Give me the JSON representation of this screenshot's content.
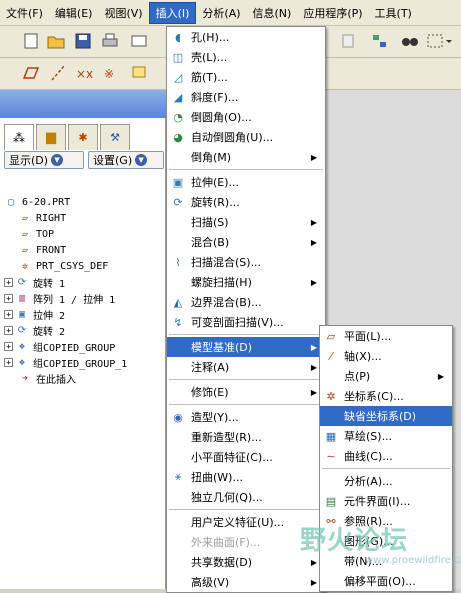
{
  "menubar": {
    "items": [
      "文件(F)",
      "编辑(E)",
      "视图(V)",
      "插入(I)",
      "分析(A)",
      "信息(N)",
      "应用程序(P)",
      "工具(T)"
    ],
    "active_index": 3
  },
  "panel": {
    "display_label": "显示(D)",
    "settings_label": "设置(G)",
    "tree": [
      {
        "text": "6-20.PRT",
        "icon": "part-icon",
        "expander": false,
        "indent": 0
      },
      {
        "text": "RIGHT",
        "icon": "datum-plane-icon",
        "expander": false,
        "indent": 1
      },
      {
        "text": "TOP",
        "icon": "datum-plane-icon",
        "expander": false,
        "indent": 1
      },
      {
        "text": "FRONT",
        "icon": "datum-plane-icon",
        "expander": false,
        "indent": 1
      },
      {
        "text": "PRT_CSYS_DEF",
        "icon": "csys-icon",
        "expander": false,
        "indent": 1
      },
      {
        "text": "旋转 1",
        "icon": "revolve-icon",
        "expander": true,
        "indent": 0
      },
      {
        "text": "阵列 1 / 拉伸 1",
        "icon": "pattern-icon",
        "expander": true,
        "indent": 0
      },
      {
        "text": "拉伸 2",
        "icon": "extrude-icon",
        "expander": true,
        "indent": 0
      },
      {
        "text": "旋转 2",
        "icon": "revolve-icon",
        "expander": true,
        "indent": 0
      },
      {
        "text": "组COPIED_GROUP",
        "icon": "group-icon",
        "expander": true,
        "indent": 0
      },
      {
        "text": "组COPIED_GROUP_1",
        "icon": "group-icon",
        "expander": true,
        "indent": 0
      },
      {
        "text": "在此插入",
        "icon": "insert-arrow-icon",
        "expander": false,
        "indent": 1
      }
    ]
  },
  "insert_menu": [
    {
      "label": "孔(H)...",
      "icon": "hole-icon",
      "submenu": false,
      "disabled": false,
      "highlight": false
    },
    {
      "label": "壳(L)...",
      "icon": "shell-icon",
      "submenu": false,
      "disabled": false,
      "highlight": false
    },
    {
      "label": "筋(T)...",
      "icon": "rib-icon",
      "submenu": false,
      "disabled": false,
      "highlight": false
    },
    {
      "label": "斜度(F)...",
      "icon": "draft-icon",
      "submenu": false,
      "disabled": false,
      "highlight": false
    },
    {
      "label": "倒圆角(O)...",
      "icon": "round-icon",
      "submenu": false,
      "disabled": false,
      "highlight": false
    },
    {
      "label": "自动倒圆角(U)...",
      "icon": "auto-round-icon",
      "submenu": false,
      "disabled": false,
      "highlight": false
    },
    {
      "label": "倒角(M)",
      "icon": "",
      "submenu": true,
      "disabled": false,
      "highlight": false
    },
    {
      "sep": true
    },
    {
      "label": "拉伸(E)...",
      "icon": "extrude-icon",
      "submenu": false,
      "disabled": false,
      "highlight": false
    },
    {
      "label": "旋转(R)...",
      "icon": "revolve-icon",
      "submenu": false,
      "disabled": false,
      "highlight": false
    },
    {
      "label": "扫描(S)",
      "icon": "",
      "submenu": true,
      "disabled": false,
      "highlight": false
    },
    {
      "label": "混合(B)",
      "icon": "",
      "submenu": true,
      "disabled": false,
      "highlight": false
    },
    {
      "label": "扫描混合(S)...",
      "icon": "swept-blend-icon",
      "submenu": false,
      "disabled": false,
      "highlight": false
    },
    {
      "label": "螺旋扫描(H)",
      "icon": "",
      "submenu": true,
      "disabled": false,
      "highlight": false
    },
    {
      "label": "边界混合(B)...",
      "icon": "boundary-blend-icon",
      "submenu": false,
      "disabled": false,
      "highlight": false
    },
    {
      "label": "可变剖面扫描(V)...",
      "icon": "var-section-sweep-icon",
      "submenu": false,
      "disabled": false,
      "highlight": false
    },
    {
      "sep": true
    },
    {
      "label": "模型基准(D)",
      "icon": "",
      "submenu": true,
      "disabled": false,
      "highlight": true
    },
    {
      "label": "注释(A)",
      "icon": "",
      "submenu": true,
      "disabled": false,
      "highlight": false
    },
    {
      "sep": true
    },
    {
      "label": "修饰(E)",
      "icon": "",
      "submenu": true,
      "disabled": false,
      "highlight": false
    },
    {
      "sep": true
    },
    {
      "label": "造型(Y)...",
      "icon": "style-icon",
      "submenu": false,
      "disabled": false,
      "highlight": false
    },
    {
      "label": "重新造型(R)...",
      "icon": "",
      "submenu": false,
      "disabled": false,
      "highlight": false
    },
    {
      "label": "小平面特征(C)...",
      "icon": "",
      "submenu": false,
      "disabled": false,
      "highlight": false
    },
    {
      "label": "扭曲(W)...",
      "icon": "warp-icon",
      "submenu": false,
      "disabled": false,
      "highlight": false
    },
    {
      "label": "独立几何(Q)...",
      "icon": "",
      "submenu": false,
      "disabled": false,
      "highlight": false
    },
    {
      "sep": true
    },
    {
      "label": "用户定义特征(U)...",
      "icon": "",
      "submenu": false,
      "disabled": false,
      "highlight": false
    },
    {
      "label": "外来曲面(F)...",
      "icon": "",
      "submenu": false,
      "disabled": true,
      "highlight": false
    },
    {
      "label": "共享数据(D)",
      "icon": "",
      "submenu": true,
      "disabled": false,
      "highlight": false
    },
    {
      "label": "高级(V)",
      "icon": "",
      "submenu": true,
      "disabled": false,
      "highlight": false
    }
  ],
  "datum_menu": [
    {
      "label": "平面(L)...",
      "icon": "plane-icon",
      "submenu": false,
      "highlight": false
    },
    {
      "label": "轴(X)...",
      "icon": "axis-icon",
      "submenu": false,
      "highlight": false
    },
    {
      "label": "点(P)",
      "icon": "",
      "submenu": true,
      "highlight": false
    },
    {
      "label": "坐标系(C)...",
      "icon": "csys-icon",
      "submenu": false,
      "highlight": false
    },
    {
      "label": "缺省坐标系(D)",
      "icon": "",
      "submenu": false,
      "highlight": true
    },
    {
      "label": "草绘(S)...",
      "icon": "sketch-icon",
      "submenu": false,
      "highlight": false
    },
    {
      "label": "曲线(C)...",
      "icon": "curve-icon",
      "submenu": false,
      "highlight": false
    },
    {
      "sep": true
    },
    {
      "label": "分析(A)...",
      "icon": "",
      "submenu": false,
      "highlight": false
    },
    {
      "label": "元件界面(I)...",
      "icon": "component-interface-icon",
      "submenu": false,
      "highlight": false
    },
    {
      "label": "参照(R)...",
      "icon": "reference-icon",
      "submenu": false,
      "highlight": false
    },
    {
      "label": "图形(G)...",
      "icon": "",
      "submenu": false,
      "highlight": false
    },
    {
      "label": "带(N)...",
      "icon": "",
      "submenu": false,
      "highlight": false
    },
    {
      "label": "偏移平面(O)...",
      "icon": "",
      "submenu": false,
      "highlight": false
    }
  ],
  "watermark": {
    "main": "野火论坛",
    "sub": "www.proewildfire.cn"
  },
  "colors": {
    "highlight": "#316ac5",
    "menubar": "#ece9d8"
  }
}
